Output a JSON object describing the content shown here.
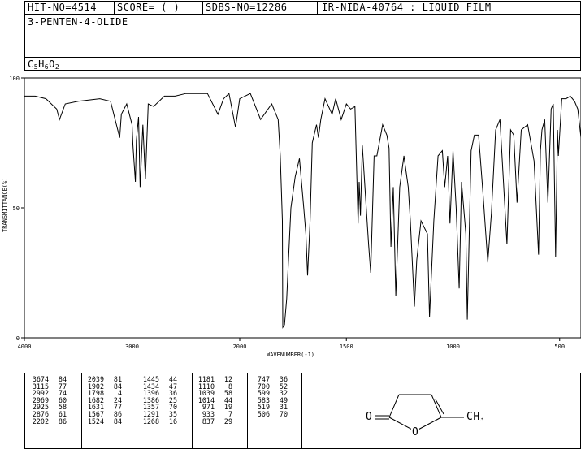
{
  "header": {
    "hit_no": "HIT-NO=4514",
    "score": "SCORE=  (   )",
    "sdbs_no": "SDBS-NO=12286",
    "ir_nida": "IR-NIDA-40764 : LIQUID FILM",
    "compound_name": "3-PENTEN-4-OLIDE",
    "formula": {
      "c": "C",
      "c_n": "5",
      "h": "H",
      "h_n": "6",
      "o": "O",
      "o_n": "2"
    }
  },
  "chart_data": {
    "type": "line",
    "xlabel": "WAVENUMBER(-1)",
    "ylabel": "TRANSMITTANCE(%)",
    "x_ticks": [
      4000,
      3000,
      2000,
      1500,
      1000,
      500
    ],
    "y_ticks": [
      0,
      50,
      100
    ],
    "xlim": [
      4000,
      400
    ],
    "ylim": [
      0,
      100
    ],
    "x_axis": "piecewise: 4000-2000 at half scale, 2000-400 at full scale",
    "grid": false,
    "series": [
      {
        "x": [
          4000,
          3900,
          3800,
          3700,
          3674,
          3620,
          3500,
          3300,
          3200,
          3115,
          3100,
          3050,
          3000,
          2992,
          2969,
          2960,
          2940,
          2925,
          2900,
          2876,
          2850,
          2800,
          2700,
          2600,
          2500,
          2400,
          2300,
          2202,
          2150,
          2100,
          2039,
          2000,
          1950,
          1902,
          1850,
          1820,
          1810,
          1800,
          1798,
          1790,
          1780,
          1760,
          1740,
          1720,
          1700,
          1690,
          1682,
          1670,
          1660,
          1640,
          1631,
          1620,
          1600,
          1567,
          1550,
          1524,
          1500,
          1480,
          1460,
          1445,
          1440,
          1434,
          1425,
          1410,
          1396,
          1386,
          1370,
          1357,
          1330,
          1310,
          1300,
          1291,
          1280,
          1268,
          1250,
          1230,
          1210,
          1200,
          1181,
          1170,
          1150,
          1120,
          1110,
          1090,
          1070,
          1050,
          1039,
          1025,
          1014,
          1000,
          985,
          971,
          960,
          940,
          933,
          915,
          900,
          880,
          860,
          837,
          820,
          800,
          780,
          747,
          730,
          715,
          700,
          680,
          650,
          620,
          599,
          590,
          583,
          570,
          555,
          540,
          530,
          519,
          510,
          506,
          490,
          470,
          450,
          430,
          415,
          400
        ],
        "y": [
          93,
          93,
          92,
          88,
          84,
          90,
          91,
          92,
          91,
          77,
          86,
          90,
          82,
          74,
          60,
          76,
          85,
          58,
          82,
          61,
          90,
          89,
          93,
          93,
          94,
          94,
          94,
          86,
          92,
          94,
          81,
          92,
          94,
          84,
          90,
          84,
          70,
          45,
          4,
          5,
          15,
          50,
          62,
          69,
          50,
          40,
          24,
          45,
          75,
          82,
          77,
          84,
          92,
          86,
          92,
          84,
          90,
          88,
          89,
          44,
          60,
          47,
          74,
          54,
          36,
          25,
          70,
          70,
          82,
          78,
          73,
          35,
          58,
          16,
          58,
          70,
          58,
          45,
          12,
          30,
          45,
          40,
          8,
          45,
          70,
          72,
          58,
          70,
          44,
          72,
          50,
          19,
          60,
          40,
          7,
          72,
          78,
          78,
          56,
          29,
          48,
          80,
          84,
          36,
          80,
          78,
          52,
          80,
          82,
          68,
          32,
          72,
          80,
          84,
          52,
          88,
          90,
          31,
          80,
          70,
          92,
          92,
          93,
          91,
          88,
          77
        ]
      }
    ],
    "peak_table": [
      [
        [
          "3674",
          "84"
        ],
        [
          "3115",
          "77"
        ],
        [
          "2992",
          "74"
        ],
        [
          "2969",
          "60"
        ],
        [
          "2925",
          "58"
        ],
        [
          "2876",
          "61"
        ],
        [
          "2202",
          "86"
        ]
      ],
      [
        [
          "2039",
          "81"
        ],
        [
          "1902",
          "84"
        ],
        [
          "1798",
          "4"
        ],
        [
          "1682",
          "24"
        ],
        [
          "1631",
          "77"
        ],
        [
          "1567",
          "86"
        ],
        [
          "1524",
          "84"
        ]
      ],
      [
        [
          "1445",
          "44"
        ],
        [
          "1434",
          "47"
        ],
        [
          "1396",
          "36"
        ],
        [
          "1386",
          "25"
        ],
        [
          "1357",
          "70"
        ],
        [
          "1291",
          "35"
        ],
        [
          "1268",
          "16"
        ]
      ],
      [
        [
          "1181",
          "12"
        ],
        [
          "1110",
          "8"
        ],
        [
          "1039",
          "58"
        ],
        [
          "1014",
          "44"
        ],
        [
          "971",
          "19"
        ],
        [
          "933",
          "7"
        ],
        [
          "837",
          "29"
        ]
      ],
      [
        [
          "747",
          "36"
        ],
        [
          "700",
          "52"
        ],
        [
          "599",
          "32"
        ],
        [
          "583",
          "49"
        ],
        [
          "519",
          "31"
        ],
        [
          "506",
          "70"
        ]
      ]
    ]
  },
  "structure": {
    "label_o": "O",
    "label_ring_o": "O",
    "label_ch": "CH",
    "label_3": "3"
  }
}
